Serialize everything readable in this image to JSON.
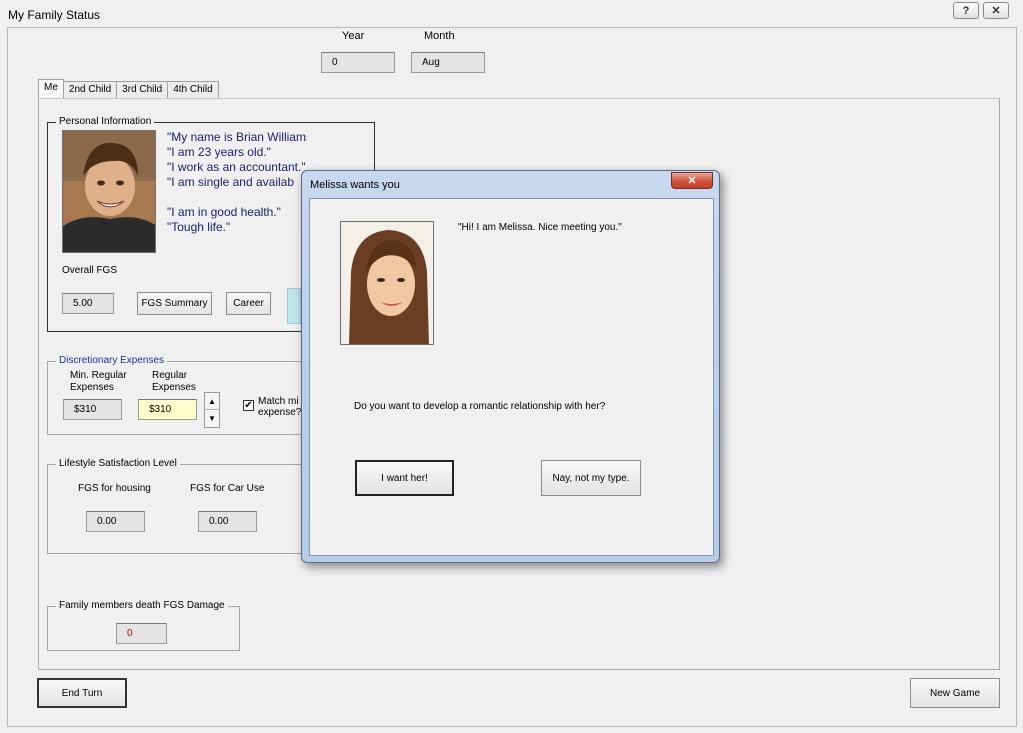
{
  "window": {
    "title": "My Family Status",
    "help_glyph": "?",
    "close_glyph": "✕"
  },
  "header": {
    "year_label": "Year",
    "year_value": "0",
    "month_label": "Month",
    "month_value": "Aug"
  },
  "tabs": [
    {
      "label": "Me",
      "active": true
    },
    {
      "label": "2nd Child",
      "active": false
    },
    {
      "label": "3rd Child",
      "active": false
    },
    {
      "label": "4th Child",
      "active": false
    }
  ],
  "personal": {
    "legend": "Personal Information",
    "quotes": [
      "\"My name is Brian Williams.\"",
      "\"I am 23 years old.\"",
      "\"I work as an accountant.\"",
      "\"I am single and availab"
    ],
    "quotes2": [
      "\"I am in good health.\"",
      "\"Tough life.\""
    ],
    "overall_label": "Overall FGS",
    "overall_value": "5.00",
    "fgs_summary_btn": "FGS Summary",
    "career_btn": "Career"
  },
  "discretionary": {
    "legend": "Discretionary Expenses",
    "min_label_1": "Min. Regular",
    "min_label_2": "Expenses",
    "reg_label_1": "Regular",
    "reg_label_2": "Expenses",
    "min_value": "$310",
    "reg_value": "$310",
    "match_label_1": "Match mi",
    "match_label_2": "expense?",
    "checked_glyph": "✔",
    "spin_up": "▲",
    "spin_down": "▼"
  },
  "lifestyle": {
    "legend": "Lifestyle Satisfaction Level",
    "housing_label": "FGS for housing",
    "housing_value": "0.00",
    "car_label": "FGS for Car Use",
    "car_value": "0.00"
  },
  "death": {
    "legend": "Family members death FGS Damage",
    "value": "0"
  },
  "footer": {
    "end_turn": "End Turn",
    "new_game": "New Game"
  },
  "dialog": {
    "title": "Melissa wants you",
    "close_glyph": "✕",
    "greeting": "\"Hi! I am Melissa. Nice meeting you.\"",
    "question": "Do you want to develop a romantic relationship with her?",
    "yes_btn": "I want her!",
    "no_btn": "Nay, not my type."
  },
  "colors": {
    "quote_text": "#1c1c6e",
    "legend_blue": "#1a2f9c",
    "highlight_field": "#ffffcc",
    "damage_red": "#cc0000"
  }
}
